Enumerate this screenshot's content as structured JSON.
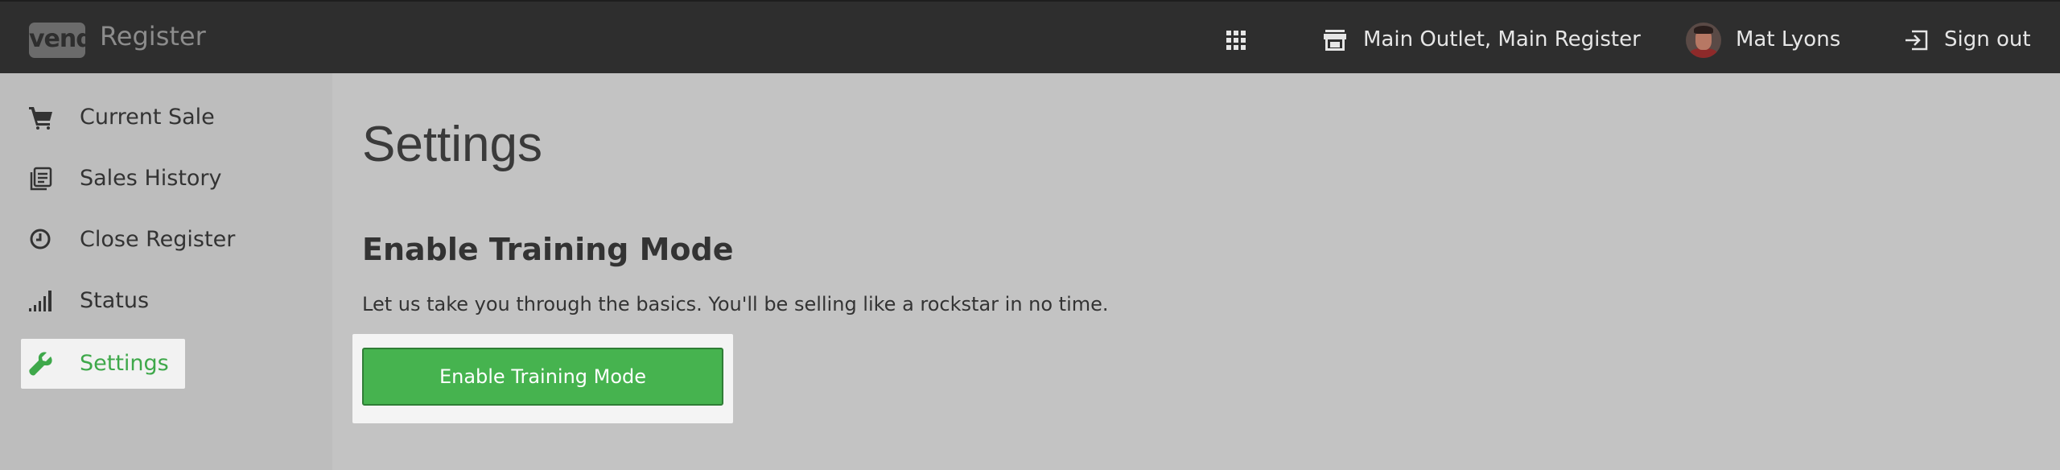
{
  "header": {
    "logo_text": "vend",
    "app_title": "Register",
    "outlet": "Main Outlet, Main Register",
    "user_name": "Mat Lyons",
    "sign_out": "Sign out",
    "icons": {
      "apps": "grid-icon",
      "outlet": "store-icon",
      "sign_out": "sign-out-icon"
    }
  },
  "sidebar": {
    "items": [
      {
        "label": "Current Sale",
        "icon": "cart-icon",
        "active": false
      },
      {
        "label": "Sales History",
        "icon": "history-icon",
        "active": false
      },
      {
        "label": "Close Register",
        "icon": "clock-icon",
        "active": false
      },
      {
        "label": "Status",
        "icon": "signal-icon",
        "active": false
      },
      {
        "label": "Settings",
        "icon": "wrench-icon",
        "active": true
      }
    ]
  },
  "main": {
    "title": "Settings",
    "section_title": "Enable Training Mode",
    "description": "Let us take you through the basics. You'll be selling like a rockstar in no time.",
    "button_label": "Enable Training Mode"
  },
  "colors": {
    "topbar": "#2e2e2e",
    "accent": "#46b34f",
    "active_text": "#3ea84a",
    "background": "#c3c3c3"
  }
}
